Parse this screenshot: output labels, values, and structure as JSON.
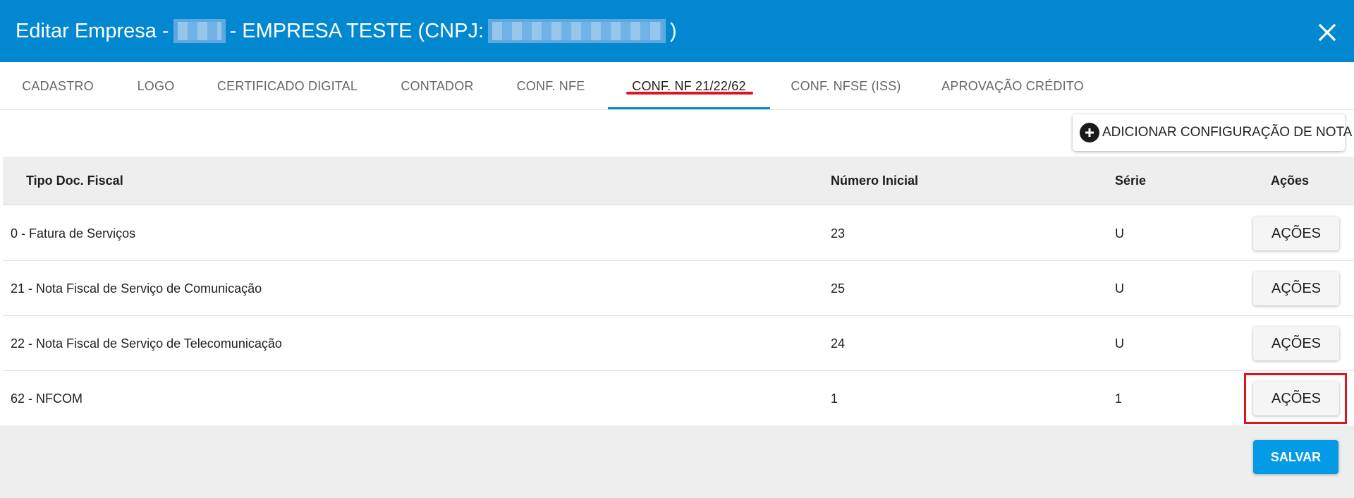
{
  "dialog": {
    "title_prefix": "Editar Empresa -",
    "title_middle": "- EMPRESA TESTE (CNPJ:",
    "title_suffix": ")",
    "header_color": "#0288d1",
    "close_icon": "close-icon"
  },
  "tabs": [
    {
      "label": "CADASTRO",
      "active": false
    },
    {
      "label": "LOGO",
      "active": false
    },
    {
      "label": "CERTIFICADO DIGITAL",
      "active": false
    },
    {
      "label": "CONTADOR",
      "active": false
    },
    {
      "label": "CONF. NFE",
      "active": false
    },
    {
      "label": "CONF. NF 21/22/62",
      "active": true
    },
    {
      "label": "CONF. NFSE (ISS)",
      "active": false
    },
    {
      "label": "APROVAÇÃO CRÉDITO",
      "active": false
    }
  ],
  "toolbar": {
    "add_label": "ADICIONAR CONFIGURAÇÃO DE NOTA",
    "add_icon": "plus-circle-icon"
  },
  "table": {
    "headers": {
      "tipo": "Tipo Doc. Fiscal",
      "numero": "Número Inicial",
      "serie": "Série",
      "acoes": "Ações"
    },
    "rows": [
      {
        "tipo": "0 - Fatura de Serviços",
        "numero": "23",
        "serie": "U",
        "action": "AÇÕES"
      },
      {
        "tipo": "21 - Nota Fiscal de Serviço de Comunicação",
        "numero": "25",
        "serie": "U",
        "action": "AÇÕES"
      },
      {
        "tipo": "22 - Nota Fiscal de Serviço de Telecomunicação",
        "numero": "24",
        "serie": "U",
        "action": "AÇÕES"
      },
      {
        "tipo": "62 - NFCOM",
        "numero": "1",
        "serie": "1",
        "action": "AÇÕES"
      }
    ]
  },
  "footer": {
    "save_label": "SALVAR",
    "save_color": "#039be5"
  },
  "annotations": {
    "highlight_color": "#e0141e"
  }
}
